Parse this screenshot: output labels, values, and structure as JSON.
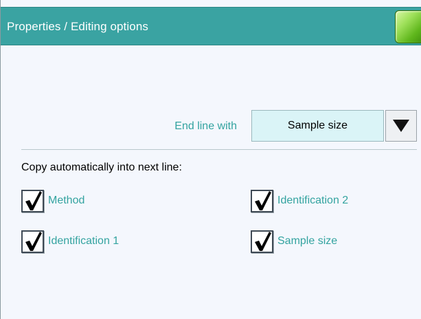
{
  "window": {
    "title": "Properties / Editing options"
  },
  "end_line": {
    "label": "End line with",
    "selected_value": "Sample size"
  },
  "copy_section": {
    "heading": "Copy automatically into next line:",
    "options": [
      {
        "label": "Method",
        "checked": true
      },
      {
        "label": "Identification 2",
        "checked": true
      },
      {
        "label": "Identification 1",
        "checked": true
      },
      {
        "label": "Sample size",
        "checked": true
      }
    ]
  },
  "icons": {
    "home": "home-button-icon",
    "dropdown": "triangle-down-icon",
    "check": "checkmark-icon"
  },
  "colors": {
    "title_bar": "#3aa3a2",
    "accent_text": "#33a3a0",
    "select_bg": "#daf4f7",
    "background": "#f4f7fd"
  }
}
